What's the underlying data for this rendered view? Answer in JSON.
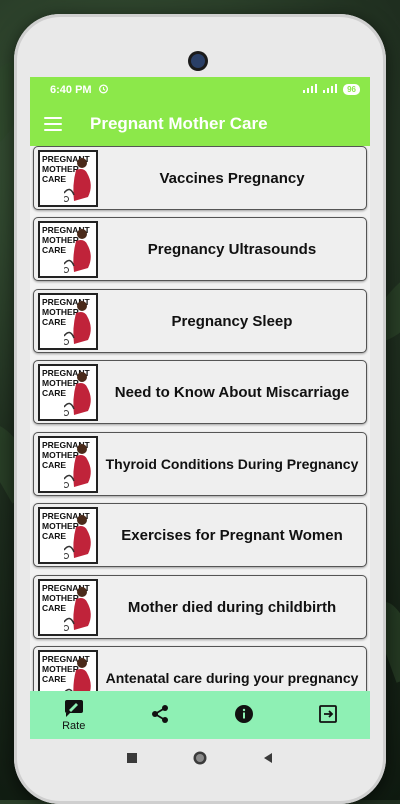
{
  "status": {
    "time": "6:40 PM",
    "battery": "96"
  },
  "app": {
    "title": "Pregnant Mother Care"
  },
  "thumb": {
    "line1": "PREGNANT",
    "line2": "MOTHER",
    "line3": "CARE"
  },
  "items": [
    {
      "label": "Vaccines Pregnancy"
    },
    {
      "label": "Pregnancy Ultrasounds"
    },
    {
      "label": "Pregnancy Sleep"
    },
    {
      "label": "Need to Know About Miscarriage"
    },
    {
      "label": "Thyroid Conditions During Pregnancy"
    },
    {
      "label": "Exercises for Pregnant Women"
    },
    {
      "label": "Mother died during childbirth"
    },
    {
      "label": "Antenatal care during your pregnancy"
    }
  ],
  "bottom_nav": {
    "rate_label": "Rate",
    "icons": [
      "rate-icon",
      "share-icon",
      "info-icon",
      "exit-icon"
    ]
  },
  "colors": {
    "appbar": "#8ce84a",
    "bottom_nav": "#8ef0b4",
    "dress": "#c0233a"
  }
}
